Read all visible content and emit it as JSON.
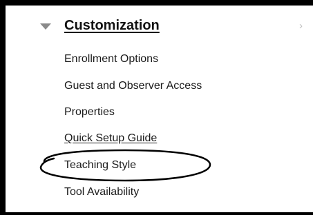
{
  "section": {
    "title": "Customization",
    "collapse_icon": "triangle-down-icon",
    "chevron_icon": "chevron-right-icon",
    "chevron_glyph": "›"
  },
  "menu": {
    "items": [
      {
        "label": "Enrollment Options"
      },
      {
        "label": "Guest and Observer Access"
      },
      {
        "label": "Properties"
      },
      {
        "label": "Quick Setup Guide"
      },
      {
        "label": "Teaching Style"
      },
      {
        "label": "Tool Availability"
      }
    ]
  },
  "colors": {
    "border": "#000000",
    "text": "#1a1a1a",
    "toggle": "#8a8a8a",
    "chevron": "#bdbdbd",
    "annotation": "#000000"
  }
}
